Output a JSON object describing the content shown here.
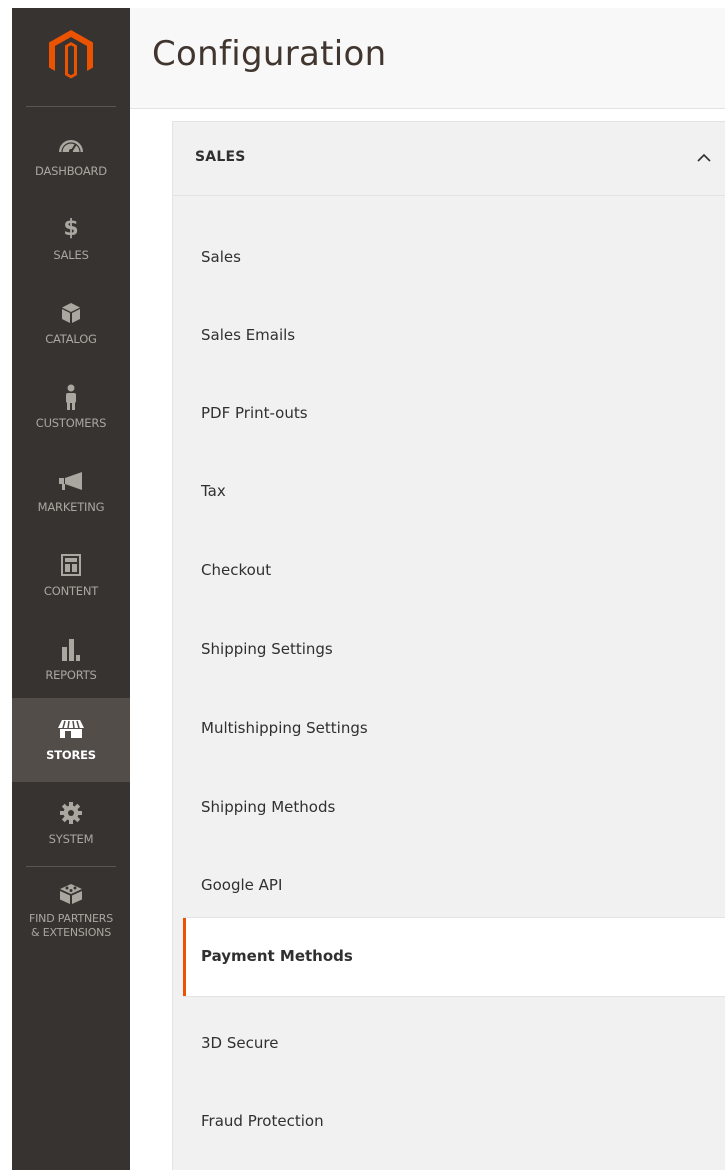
{
  "header": {
    "title": "Configuration"
  },
  "sidebar": {
    "logo_icon": "magento-logo-icon",
    "brand_color": "#eb5202",
    "items": [
      {
        "label": "DASHBOARD",
        "icon": "dashboard-icon",
        "active": false
      },
      {
        "label": "SALES",
        "icon": "dollar-icon",
        "active": false
      },
      {
        "label": "CATALOG",
        "icon": "box-icon",
        "active": false
      },
      {
        "label": "CUSTOMERS",
        "icon": "person-icon",
        "active": false
      },
      {
        "label": "MARKETING",
        "icon": "megaphone-icon",
        "active": false
      },
      {
        "label": "CONTENT",
        "icon": "layout-icon",
        "active": false
      },
      {
        "label": "REPORTS",
        "icon": "bar-chart-icon",
        "active": false
      },
      {
        "label": "STORES",
        "icon": "store-icon",
        "active": true
      },
      {
        "label": "SYSTEM",
        "icon": "gear-icon",
        "active": false
      },
      {
        "label_line1": "FIND PARTNERS",
        "label_line2": "& EXTENSIONS",
        "icon": "blocks-icon",
        "active": false
      }
    ]
  },
  "config_nav": {
    "section_title": "SALES",
    "section_toggle_icon": "chevron-up-icon",
    "items": [
      {
        "label": "Sales",
        "active": false
      },
      {
        "label": "Sales Emails",
        "active": false
      },
      {
        "label": "PDF Print-outs",
        "active": false
      },
      {
        "label": "Tax",
        "active": false
      },
      {
        "label": "Checkout",
        "active": false
      },
      {
        "label": "Shipping Settings",
        "active": false
      },
      {
        "label": "Multishipping Settings",
        "active": false
      },
      {
        "label": "Shipping Methods",
        "active": false
      },
      {
        "label": "Google API",
        "active": false
      },
      {
        "label": "Payment Methods",
        "active": true
      },
      {
        "label": "3D Secure",
        "active": false
      },
      {
        "label": "Fraud Protection",
        "active": false
      }
    ]
  },
  "colors": {
    "sidebar_bg": "#373330",
    "sidebar_active_bg": "#524d49",
    "accent": "#eb5202",
    "panel_bg": "#f1f1f1"
  }
}
